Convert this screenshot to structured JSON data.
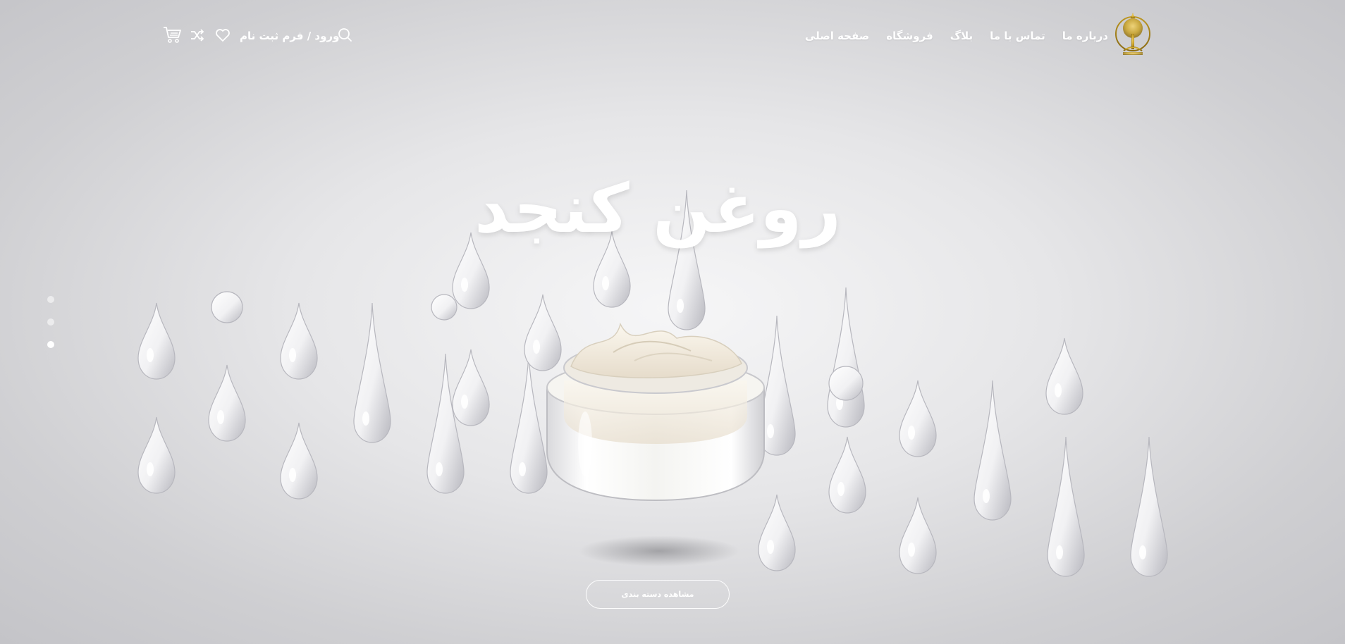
{
  "nav": {
    "items": [
      {
        "label": "صفحه اصلی"
      },
      {
        "label": "فروشگاه"
      },
      {
        "label": "بلاگ"
      },
      {
        "label": "تماس با ما"
      },
      {
        "label": "درباره ما"
      }
    ]
  },
  "header": {
    "login_label": "ورود / فرم ثبت نام",
    "icons": [
      "logo-tree",
      "search-icon",
      "heart-icon",
      "shuffle-icon",
      "cart-icon"
    ]
  },
  "hero": {
    "title": "روغن کنجد",
    "cta_label": "مشاهده دسته بندی",
    "slides_count": 3,
    "active_slide": 3
  },
  "colors": {
    "text": "#ffffff",
    "logo_gold": "#c9a227",
    "background": "#e6e6e8"
  }
}
